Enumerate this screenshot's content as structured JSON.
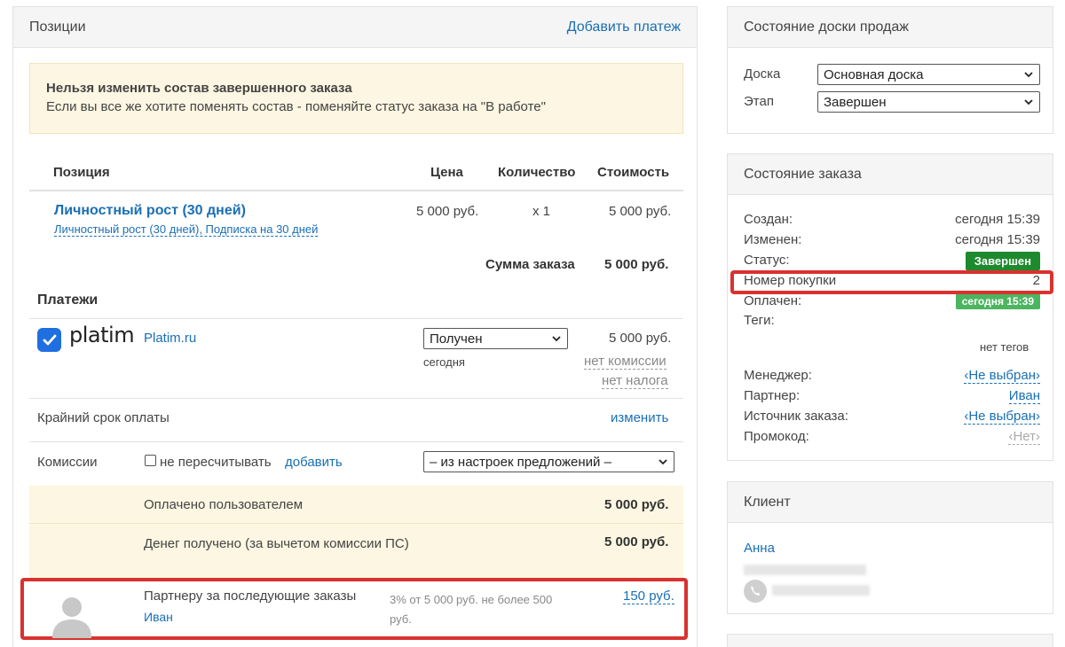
{
  "positions": {
    "title": "Позиции",
    "add_payment": "Добавить платеж",
    "warning_title": "Нельзя изменить состав завершенного заказа",
    "warning_text": "Если вы все же хотите поменять состав - поменяйте статус заказа на \"В работе\"",
    "columns": {
      "position": "Позиция",
      "price": "Цена",
      "quantity": "Количество",
      "cost": "Стоимость"
    },
    "item": {
      "name": "Личностный рост (30 дней)",
      "subtitle": "Личностный рост (30 дней), Подписка на 30 дней",
      "price": "5 000 руб.",
      "quantity": "x 1",
      "cost": "5 000 руб."
    },
    "sum_label": "Сумма заказа",
    "sum_value": "5 000 руб."
  },
  "payments": {
    "title": "Платежи",
    "logo_text": "platim",
    "provider": "Platim.ru",
    "status_select": "Получен",
    "date": "сегодня",
    "amount": "5 000 руб.",
    "no_commission": "нет комиссии",
    "no_tax": "нет налога",
    "deadline_label": "Крайний срок оплаты",
    "deadline_action": "изменить",
    "commissions_label": "Комиссии",
    "no_recalc": "не пересчитывать",
    "add": "добавить",
    "commission_select": "– из настроек предложений –",
    "paid_by_user_label": "Оплачено пользователем",
    "paid_by_user_value": "5 000 руб.",
    "money_received_label": "Денег получено (за вычетом комиссии ПС)",
    "money_received_value": "5 000 руб.",
    "partner_label": "Партнеру за последующие заказы",
    "partner_name": "Иван",
    "partner_terms": "3% от 5 000 руб. не более 500 руб.",
    "partner_amount": "150 руб."
  },
  "board": {
    "title": "Состояние доски продаж",
    "board_label": "Доска",
    "board_value": "Основная доска",
    "stage_label": "Этап",
    "stage_value": "Завершен"
  },
  "order": {
    "title": "Состояние заказа",
    "created_label": "Создан:",
    "created_value": "сегодня 15:39",
    "changed_label": "Изменен:",
    "changed_value": "сегодня 15:39",
    "status_label": "Статус:",
    "status_value": "Завершен",
    "purchase_no_label": "Номер покупки",
    "purchase_no_value": "2",
    "paid_label": "Оплачен:",
    "paid_value": "сегодня 15:39",
    "tags_label": "Теги:",
    "tags_value": "нет тегов",
    "manager_label": "Менеджер:",
    "manager_value": "‹Не выбран›",
    "partner_label": "Партнер:",
    "partner_value": "Иван",
    "source_label": "Источник заказа:",
    "source_value": "‹Не выбран›",
    "promo_label": "Промокод:",
    "promo_value": "‹Нет›"
  },
  "client": {
    "title": "Клиент",
    "name": "Анна"
  },
  "colors": {
    "link": "#1a6fb5",
    "status_green": "#1e8a2d",
    "paid_green": "#4cb560",
    "highlight_red": "#d9322f",
    "warning_bg": "#fcf6e2"
  }
}
